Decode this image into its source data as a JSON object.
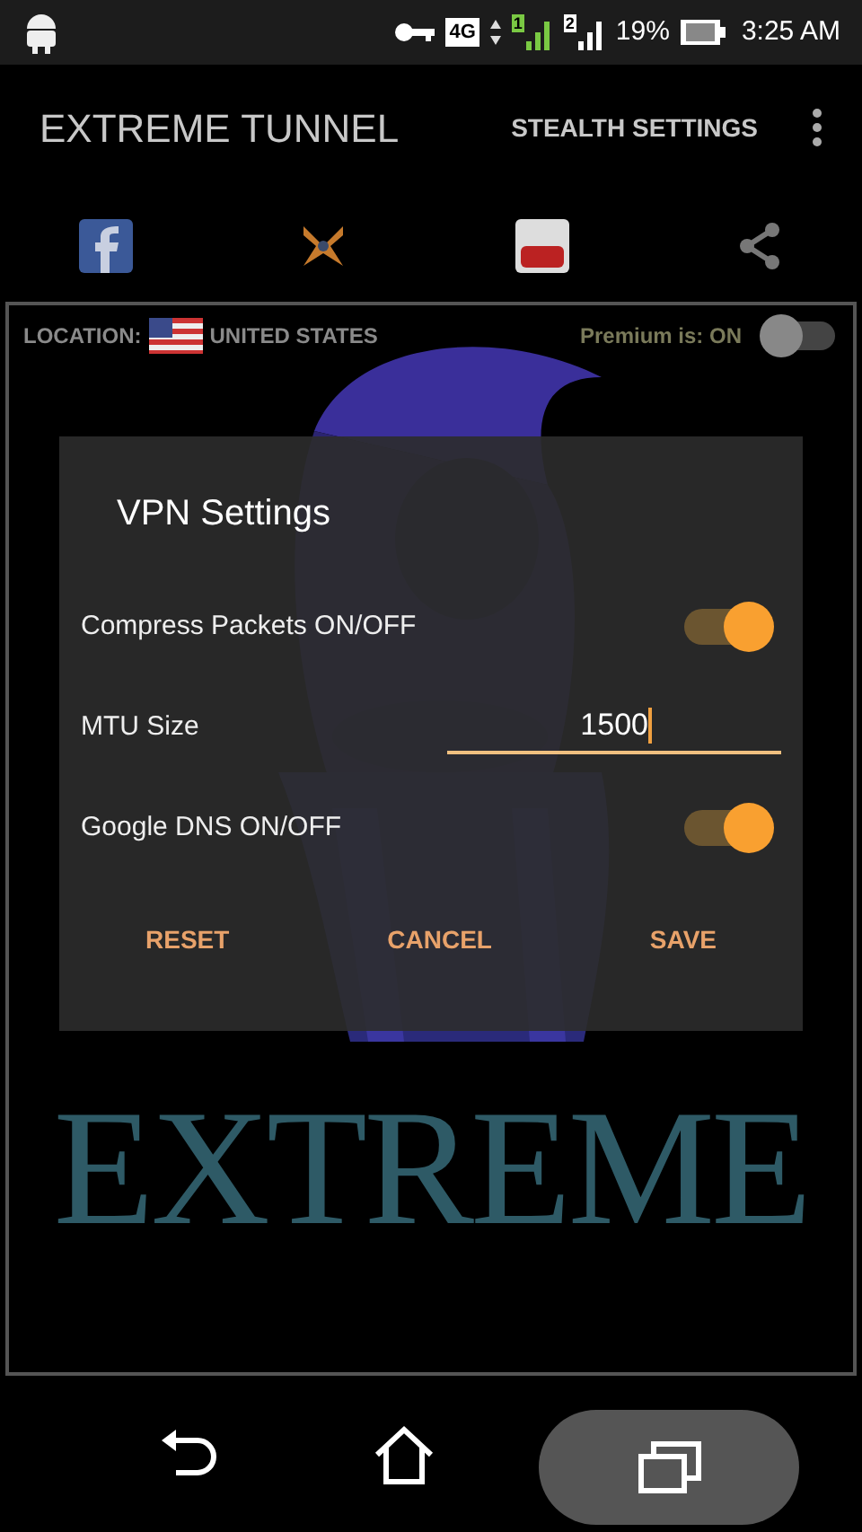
{
  "status_bar": {
    "network": "4G",
    "sim_1": "1",
    "sim_2": "2",
    "battery": "19%",
    "time": "3:25 AM"
  },
  "app_bar": {
    "title": "EXTREME TUNNEL",
    "action": "STEALTH SETTINGS"
  },
  "panel": {
    "location_label": "LOCATION:",
    "location": "UNITED STATES",
    "premium_label": "Premium is: ON",
    "premium_switch_on": false,
    "logo_text": "EXTREME"
  },
  "dialog": {
    "title": "VPN Settings",
    "rows": [
      {
        "kind": "switch",
        "label": "Compress Packets ON/OFF",
        "on": true
      },
      {
        "kind": "field",
        "label": "MTU Size",
        "value": "1500"
      },
      {
        "kind": "switch",
        "label": "Google DNS ON/OFF",
        "on": true
      }
    ],
    "buttons": [
      "RESET",
      "CANCEL",
      "SAVE"
    ]
  }
}
